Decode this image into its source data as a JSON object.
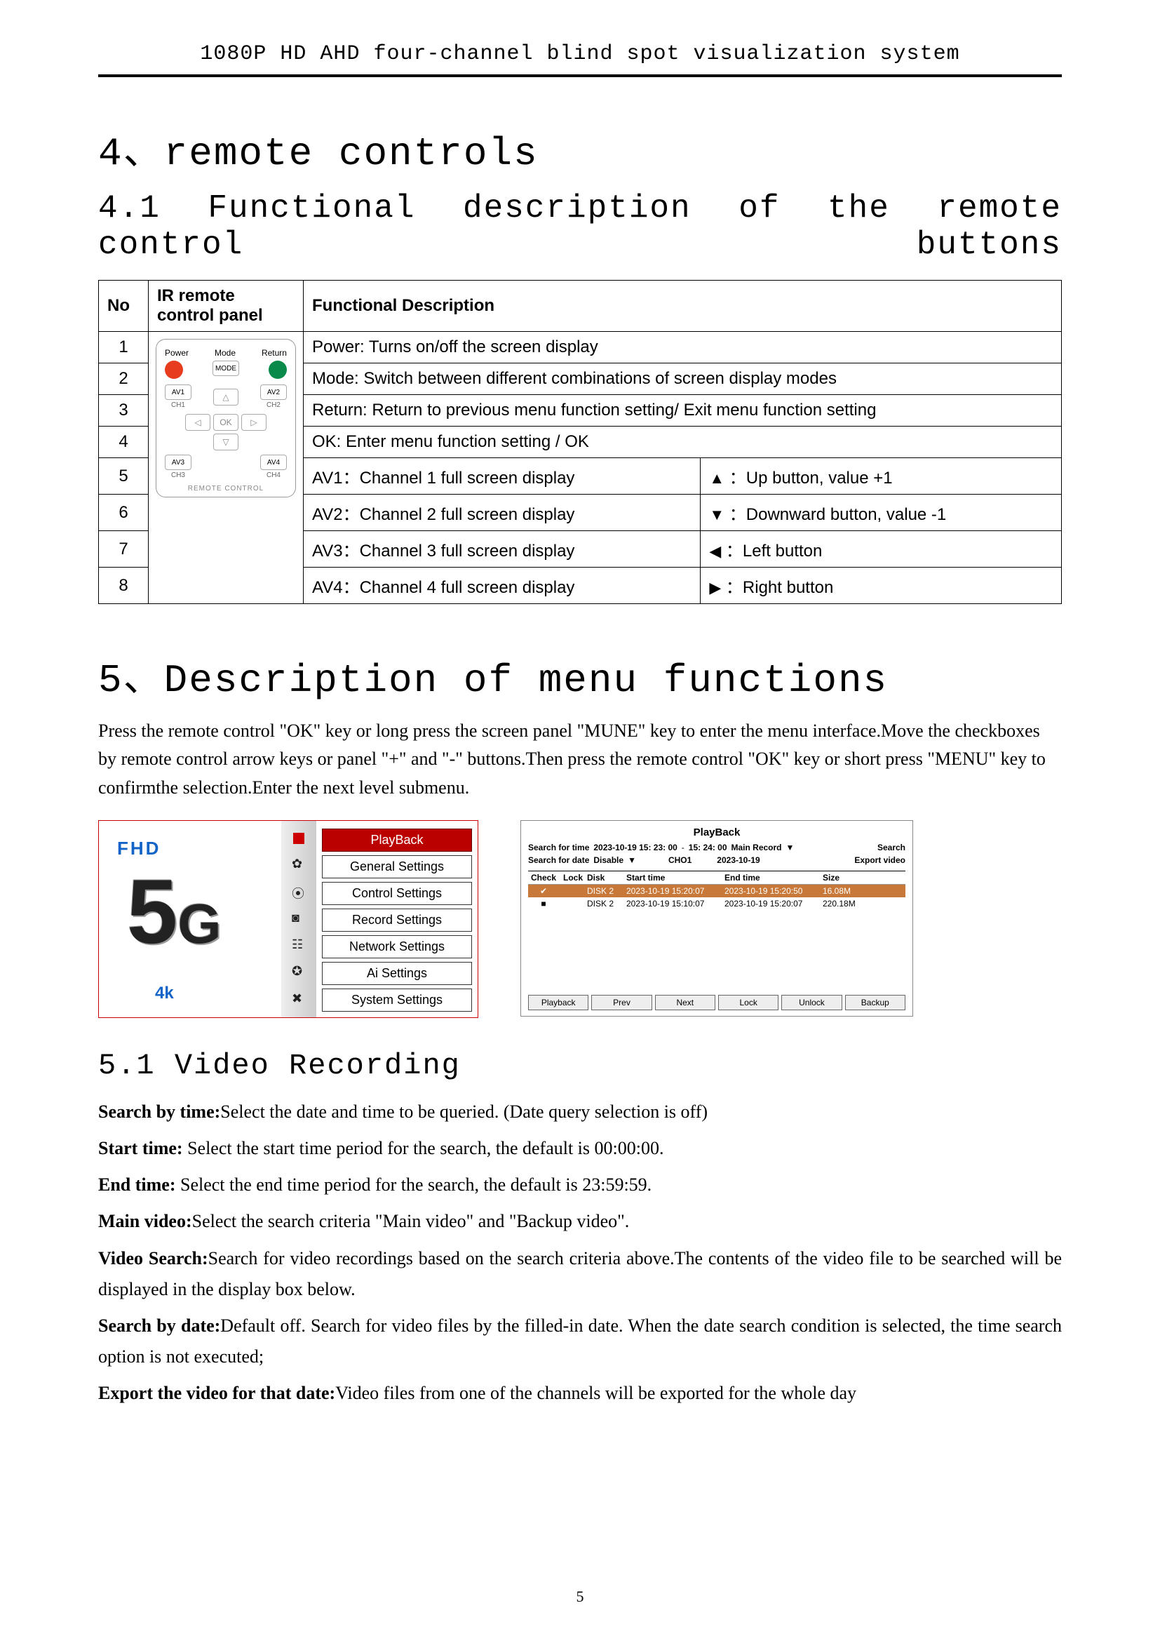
{
  "header": "1080P HD AHD four-channel blind spot visualization system",
  "sec4": {
    "title": "4、remote controls",
    "sub": "4.1 Functional description of the remote control buttons"
  },
  "table": {
    "h": [
      "No",
      "IR remote control panel",
      "Functional Description"
    ],
    "rows": [
      {
        "n": "1",
        "d": "Power: Turns on/off the screen display"
      },
      {
        "n": "2",
        "d": "Mode: Switch between different combinations of screen display modes"
      },
      {
        "n": "3",
        "d": "Return: Return to previous menu function setting/ Exit menu function setting"
      },
      {
        "n": "4",
        "d": "OK: Enter menu function setting / OK"
      },
      {
        "n": "5",
        "d": "AV1：Channel 1 full screen display",
        "s": "▲",
        "sd": "：Up button, value +1"
      },
      {
        "n": "6",
        "d": "AV2：Channel 2 full screen display",
        "s": "▼",
        "sd": "：Downward button, value -1"
      },
      {
        "n": "7",
        "d": "AV3：Channel 3 full screen display",
        "s": "◀",
        "sd": "：Left button"
      },
      {
        "n": "8",
        "d": "AV4：Channel 4 full screen display",
        "s": "▶",
        "sd": "：Right button"
      }
    ],
    "panel": {
      "l": [
        "Power",
        "Mode",
        "Return"
      ],
      "mode": "MODE",
      "av": [
        "AV1",
        "AV2",
        "AV3",
        "AV4"
      ],
      "ch": [
        "CH1",
        "CH2",
        "CH3",
        "CH4"
      ],
      "ok": "OK",
      "footer": "REMOTE CONTROL"
    }
  },
  "sec5": {
    "title": "5、Description of menu functions",
    "intro": "Press the remote control \"OK\" key or long press the screen panel \"MUNE\" key to enter the menu interface.Move the checkboxes by remote control arrow keys or panel \"+\" and \"-\" buttons.Then press the remote control \"OK\" key or short press \"MENU\" key to confirmthe selection.Enter the next level submenu."
  },
  "menu": {
    "fhd": "FHD",
    "fourk": "4k",
    "fiveg": "5",
    "items": [
      "PlayBack",
      "General Settings",
      "Control Settings",
      "Record Settings",
      "Network Settings",
      "Ai Settings",
      "System Settings"
    ]
  },
  "playback": {
    "title": "PlayBack",
    "sft": "Search for time",
    "t1": "2023-10-19 15: 23: 00",
    "dash": "-",
    "t2": "15: 24: 00",
    "mr": "Main Record",
    "dd": "▼",
    "search": "Search",
    "sfd": "Search for date",
    "dis": "Disable",
    "cho": "CHO1",
    "d2": "2023-10-19",
    "exp": "Export video",
    "th": [
      "Check",
      "Lock",
      "Disk",
      "Start time",
      "End time",
      "Size"
    ],
    "rows": [
      {
        "chk": "✔",
        "lock": "",
        "disk": "DISK 2",
        "st": "2023-10-19  15:20:07",
        "et": "2023-10-19  15:20:50",
        "sz": "16.08M"
      },
      {
        "chk": "■",
        "lock": "",
        "disk": "DISK 2",
        "st": "2023-10-19  15:10:07",
        "et": "2023-10-19  15:20:07",
        "sz": "220.18M"
      }
    ],
    "btns": [
      "Playback",
      "Prev",
      "Next",
      "Lock",
      "Unlock",
      "Backup"
    ]
  },
  "sec51": {
    "title": "5.1 Video Recording",
    "defs": [
      {
        "t": "Search by time:",
        "d": "Select the date and time to be queried. (Date query selection is off)"
      },
      {
        "t": "Start time: ",
        "d": "Select the start time period for the search, the default is 00:00:00."
      },
      {
        "t": "End time: ",
        "d": "Select the end time period for the search, the default is 23:59:59."
      },
      {
        "t": "Main video:",
        "d": "Select the search criteria \"Main video\" and \"Backup video\"."
      },
      {
        "t": "Video Search:",
        "d": "Search for video recordings based on the search criteria above.The contents of the video file to be searched will be displayed in the display box below."
      },
      {
        "t": "Search by date:",
        "d": "Default off. Search for video files by the filled-in date. When the date search condition is selected, the time search option is not executed;"
      },
      {
        "t": "Export the video for that date:",
        "d": "Video files from one of the channels will be exported for the whole day"
      }
    ]
  },
  "pagenum": "5"
}
